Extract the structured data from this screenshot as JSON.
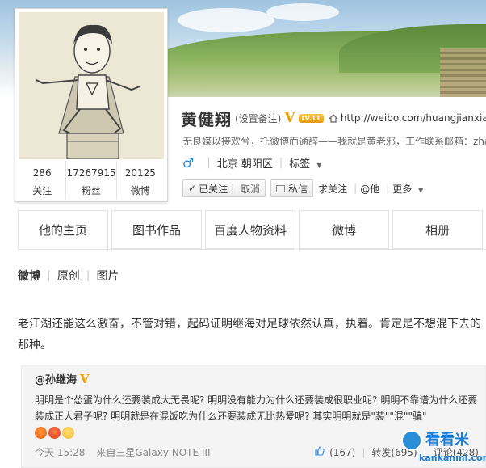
{
  "profile": {
    "name": "黄健翔",
    "remark": "(设置备注)",
    "verified_mark": "V",
    "level": "LV.11",
    "url": "http://weibo.com/huangjianxiang",
    "description": "无良媒以接欢兮，托微博而通辞——我就是黄老邪，工作联系邮箱：zha",
    "gender_symbol": "♂",
    "location": "北京 朝阳区",
    "tags_label": "标签",
    "stats": [
      {
        "value": "286",
        "label": "关注"
      },
      {
        "value": "17267915",
        "label": "粉丝"
      },
      {
        "value": "20125",
        "label": "微博"
      }
    ]
  },
  "actions": {
    "followed_label": "已关注",
    "cancel_label": "取消",
    "message_label": "私信",
    "ask_follow_label": "求关注",
    "at_label": "@他",
    "more_label": "更多"
  },
  "tabs": [
    "他的主页",
    "图书作品",
    "百度人物资料",
    "微博",
    "相册"
  ],
  "subnav": [
    "微博",
    "原创",
    "图片"
  ],
  "post": {
    "text": "老江湖还能这么激奋，不管对错，起码证明继海对足球依然认真，执着。肯定是不想混下去的那种。"
  },
  "repost": {
    "author": "@孙继海",
    "verified_mark": "V",
    "text": "明明是个怂蛋为什么还要装成大无畏呢? 明明没有能力为什么还要装成很职业呢? 明明不靠谱为什么还要装成正人君子呢? 明明就是在混饭吃为什么还要装成无比热爱呢? 其实明明就是\"装\"\"混\"\"骗\"",
    "emojis": [
      "angry-emoji",
      "mad-emoji",
      "shy-emoji"
    ],
    "time": "今天 15:28",
    "source": "来自三星Galaxy NOTE III",
    "likes": "(167)",
    "forward": "转发(695)",
    "comment": "评论(428)"
  },
  "watermark": {
    "title": "看看米",
    "domain": "kankanmi.com"
  },
  "colors": {
    "accent_blue": "#1e88d6",
    "verified_gold": "#f2a200",
    "border": "#e2e2e2"
  }
}
